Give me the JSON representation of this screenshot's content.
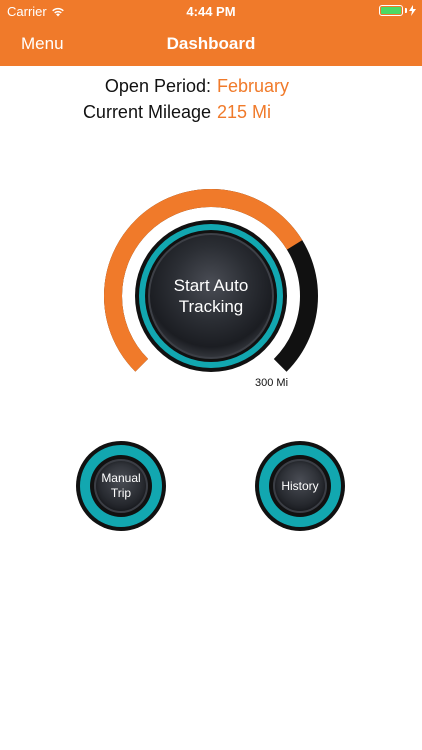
{
  "status_bar": {
    "carrier": "Carrier",
    "time": "4:44 PM"
  },
  "nav": {
    "menu_label": "Menu",
    "title": "Dashboard"
  },
  "info": {
    "open_period_label": "Open Period:",
    "open_period_value": "February",
    "mileage_label": "Current Mileage",
    "mileage_value": "215 Mi"
  },
  "gauge": {
    "button_line1": "Start Auto",
    "button_line2": "Tracking",
    "limit_label": "300 Mi",
    "current_miles": 215,
    "max_miles": 300
  },
  "buttons": {
    "manual_line1": "Manual",
    "manual_line2": "Trip",
    "history": "History"
  },
  "colors": {
    "accent": "#F07A2A",
    "teal": "#12A7B0",
    "dark": "#111111"
  }
}
